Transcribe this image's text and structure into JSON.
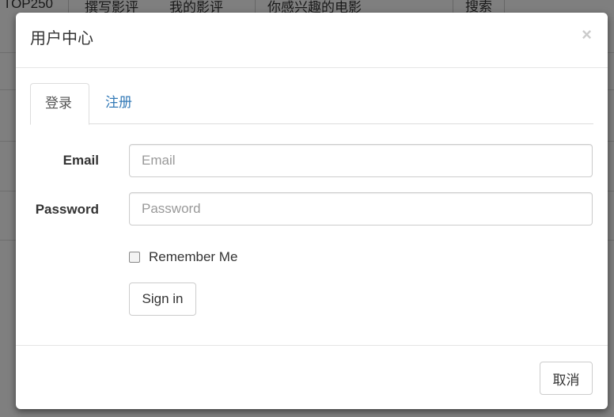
{
  "background_nav": {
    "items": [
      "TOP250",
      "撰写影评",
      "我的影评",
      "你感兴趣的电影"
    ],
    "search_button": "搜索"
  },
  "modal": {
    "title": "用户中心",
    "close_symbol": "×",
    "tabs": [
      {
        "label": "登录",
        "active": true
      },
      {
        "label": "注册",
        "active": false
      }
    ],
    "form": {
      "email_label": "Email",
      "email_placeholder": "Email",
      "email_value": "",
      "password_label": "Password",
      "password_placeholder": "Password",
      "password_value": "",
      "remember_label": "Remember Me",
      "remember_checked": false,
      "submit_label": "Sign in"
    },
    "footer": {
      "cancel_label": "取消"
    }
  },
  "colors": {
    "link": "#337ab7",
    "backdrop": "rgba(0,0,0,0.5)"
  }
}
